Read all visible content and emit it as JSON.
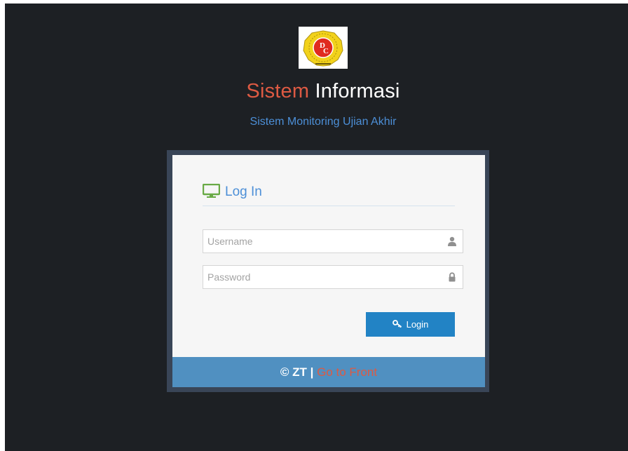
{
  "header": {
    "title_part1": "Sistem",
    "title_part2": "Informasi",
    "subtitle": "Sistem Monitoring Ujian Akhir"
  },
  "login": {
    "heading": "Log In",
    "heading_icon": "desktop-icon",
    "username": {
      "value": "",
      "placeholder": "Username",
      "icon": "user-icon"
    },
    "password": {
      "value": "",
      "placeholder": "Password",
      "icon": "lock-icon"
    },
    "button_label": "Login",
    "button_icon": "key-icon"
  },
  "footer": {
    "copyright": "© ZT |",
    "link_text": "Go to Front"
  },
  "colors": {
    "background": "#1d2024",
    "title_accent": "#dd5a43",
    "subtitle": "#4c8fd7",
    "heading_icon": "#69aa46",
    "button": "#2283c5",
    "footer": "#5090c1",
    "frame": "#394557"
  }
}
